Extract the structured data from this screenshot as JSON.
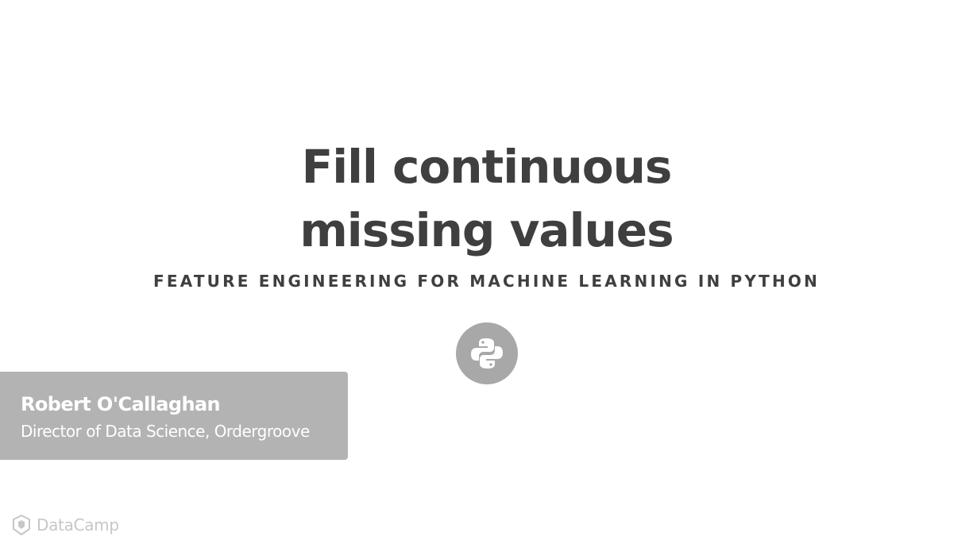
{
  "slide": {
    "title_line1": "Fill continuous",
    "title_line2": "missing values",
    "course": "FEATURE ENGINEERING FOR MACHINE LEARNING IN PYTHON"
  },
  "author": {
    "name": "Robert O'Callaghan",
    "role": "Director of Data Science, Ordergroove"
  },
  "brand": {
    "name": "DataCamp"
  },
  "icons": {
    "course_logo": "python-icon",
    "brand_logo": "datacamp-icon"
  },
  "colors": {
    "title": "#3f3f3f",
    "badge": "#a8a8a8",
    "author_card": "#b3b3b3",
    "brand": "#c7c7c7"
  }
}
